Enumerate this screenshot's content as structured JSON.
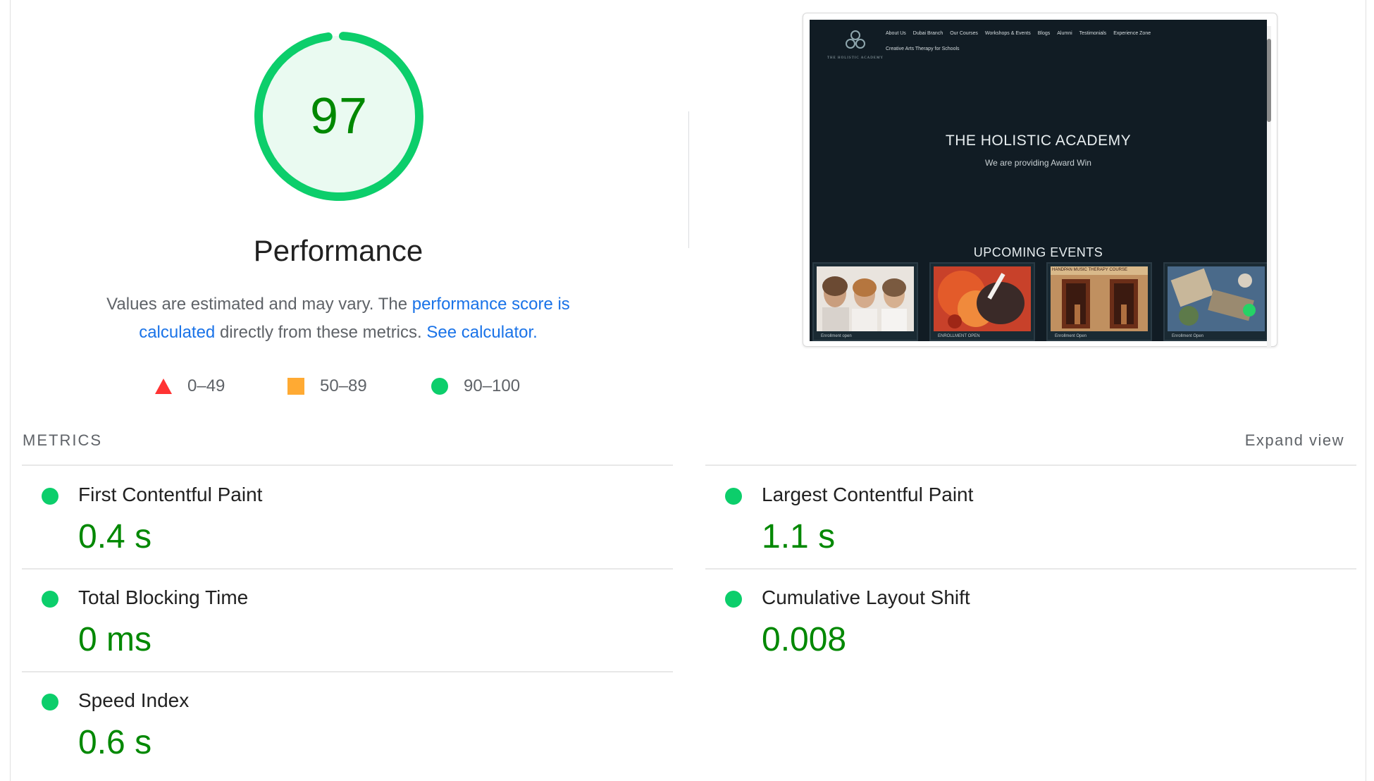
{
  "score": {
    "value": "97",
    "fraction": 0.97,
    "color": "#0cce6b",
    "fill_color": "#eafaf1",
    "text_color": "#008800"
  },
  "title": "Performance",
  "description": {
    "prefix": "Values are estimated and may vary. The ",
    "link1": "performance score is calculated",
    "middle": " directly from these metrics. ",
    "link2": "See calculator."
  },
  "legend": [
    {
      "shape": "triangle",
      "range": "0–49",
      "color": "#ff3333"
    },
    {
      "shape": "square",
      "range": "50–89",
      "color": "#ffaa33"
    },
    {
      "shape": "circle",
      "range": "90–100",
      "color": "#0cce6b"
    }
  ],
  "screenshot": {
    "brand": "THE HOLISTIC ACADEMY",
    "nav": [
      "About Us",
      "Dubai Branch",
      "Our Courses",
      "Workshops & Events",
      "Blogs",
      "Alumni",
      "Testimonials",
      "Experience Zone"
    ],
    "nav_row2": "Creative Arts Therapy for Schools",
    "hero_title": "THE HOLISTIC ACADEMY",
    "hero_subtitle": "We are providing Award Win",
    "events_title": "UPCOMING EVENTS",
    "event_captions": [
      "Enrollment open",
      "ENROLLMENT OPEN",
      "Enrollment Open",
      "Enrollment Open"
    ],
    "event3_banner": "HANDPAN MUSIC THERAPY COURSE",
    "background_color": "#111c24"
  },
  "metrics": {
    "header": "METRICS",
    "expand_label": "Expand view",
    "items": [
      {
        "label": "First Contentful Paint",
        "value": "0.4 s"
      },
      {
        "label": "Largest Contentful Paint",
        "value": "1.1 s"
      },
      {
        "label": "Total Blocking Time",
        "value": "0 ms"
      },
      {
        "label": "Cumulative Layout Shift",
        "value": "0.008"
      },
      {
        "label": "Speed Index",
        "value": "0.6 s"
      }
    ],
    "status_color": "#0cce6b",
    "value_color": "#008800"
  }
}
